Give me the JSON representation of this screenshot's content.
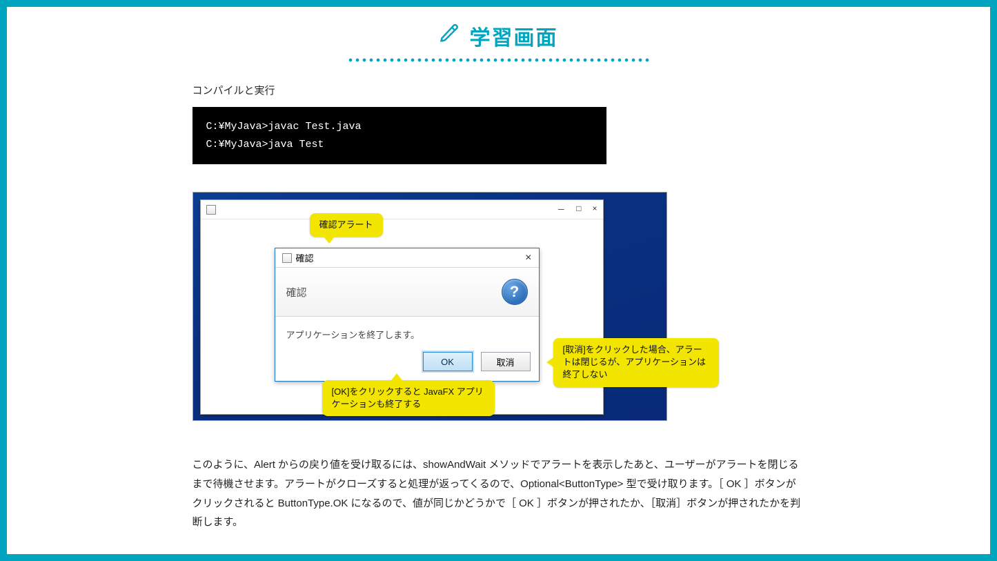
{
  "header": {
    "title": "学習画面"
  },
  "section": {
    "label": "コンパイルと実行"
  },
  "console": {
    "line1": "C:¥MyJava>javac Test.java",
    "line2": "C:¥MyJava>java Test"
  },
  "outer_window": {
    "minimize": "－",
    "maximize": "□",
    "close": "×"
  },
  "dialog": {
    "title": "確認",
    "close": "×",
    "header_text": "確認",
    "question_glyph": "?",
    "body": "アプリケーションを終了します。",
    "ok_label": "OK",
    "cancel_label": "取消"
  },
  "callouts": {
    "c1": "確認アラート",
    "c2": "[OK]をクリックすると JavaFX アプリケーションも終了する",
    "c3": "[取消]をクリックした場合、アラートは閉じるが、アプリケーションは終了しない"
  },
  "paragraph": "このように、Alert からの戻り値を受け取るには、showAndWait メソッドでアラートを表示したあと、ユーザーがアラートを閉じるまで待機させます。アラートがクローズすると処理が返ってくるので、Optional<ButtonType> 型で受け取ります。［ OK ］ボタンがクリックされると ButtonType.OK になるので、値が同じかどうかで［ OK ］ボタンが押されたか、［取消］ボタンが押されたかを判断します。"
}
